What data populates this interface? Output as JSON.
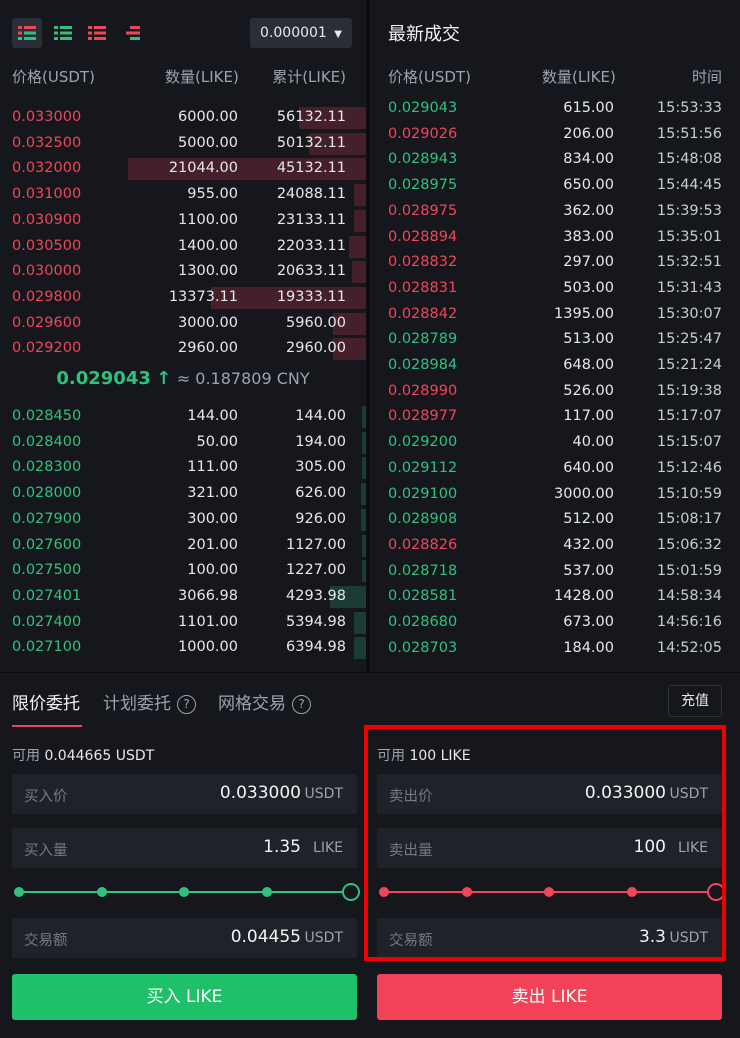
{
  "toolbar": {
    "precision": "0.000001"
  },
  "orderbook": {
    "headers": {
      "price": "价格(USDT)",
      "amount": "数量(LIKE)",
      "total": "累计(LIKE)"
    },
    "asks": [
      {
        "price": "0.033000",
        "amount": "6000.00",
        "total": "56132.11",
        "depth": 0.28
      },
      {
        "price": "0.032500",
        "amount": "5000.00",
        "total": "50132.11",
        "depth": 0.24
      },
      {
        "price": "0.032000",
        "amount": "21044.00",
        "total": "45132.11",
        "depth": 1.0
      },
      {
        "price": "0.031000",
        "amount": "955.00",
        "total": "24088.11",
        "depth": 0.05
      },
      {
        "price": "0.030900",
        "amount": "1100.00",
        "total": "23133.11",
        "depth": 0.05
      },
      {
        "price": "0.030500",
        "amount": "1400.00",
        "total": "22033.11",
        "depth": 0.07
      },
      {
        "price": "0.030000",
        "amount": "1300.00",
        "total": "20633.11",
        "depth": 0.06
      },
      {
        "price": "0.029800",
        "amount": "13373.11",
        "total": "19333.11",
        "depth": 0.65
      },
      {
        "price": "0.029600",
        "amount": "3000.00",
        "total": "5960.00",
        "depth": 0.14
      },
      {
        "price": "0.029200",
        "amount": "2960.00",
        "total": "2960.00",
        "depth": 0.14
      }
    ],
    "mid": {
      "price": "0.029043",
      "arrow": "↑",
      "approx": "≈ 0.187809 CNY"
    },
    "bids": [
      {
        "price": "0.028450",
        "amount": "144.00",
        "total": "144.00",
        "depth": 0.01
      },
      {
        "price": "0.028400",
        "amount": "50.00",
        "total": "194.00",
        "depth": 0.01
      },
      {
        "price": "0.028300",
        "amount": "111.00",
        "total": "305.00",
        "depth": 0.01
      },
      {
        "price": "0.028000",
        "amount": "321.00",
        "total": "626.00",
        "depth": 0.02
      },
      {
        "price": "0.027900",
        "amount": "300.00",
        "total": "926.00",
        "depth": 0.02
      },
      {
        "price": "0.027600",
        "amount": "201.00",
        "total": "1127.00",
        "depth": 0.01
      },
      {
        "price": "0.027500",
        "amount": "100.00",
        "total": "1227.00",
        "depth": 0.01
      },
      {
        "price": "0.027401",
        "amount": "3066.98",
        "total": "4293.98",
        "depth": 0.15
      },
      {
        "price": "0.027400",
        "amount": "1101.00",
        "total": "5394.98",
        "depth": 0.05
      },
      {
        "price": "0.027100",
        "amount": "1000.00",
        "total": "6394.98",
        "depth": 0.05
      }
    ]
  },
  "trades": {
    "title": "最新成交",
    "headers": {
      "price": "价格(USDT)",
      "amount": "数量(LIKE)",
      "time": "时间"
    },
    "rows": [
      {
        "price": "0.029043",
        "amount": "615.00",
        "time": "15:53:33",
        "side": "buy"
      },
      {
        "price": "0.029026",
        "amount": "206.00",
        "time": "15:51:56",
        "side": "sell"
      },
      {
        "price": "0.028943",
        "amount": "834.00",
        "time": "15:48:08",
        "side": "buy"
      },
      {
        "price": "0.028975",
        "amount": "650.00",
        "time": "15:44:45",
        "side": "buy"
      },
      {
        "price": "0.028975",
        "amount": "362.00",
        "time": "15:39:53",
        "side": "sell"
      },
      {
        "price": "0.028894",
        "amount": "383.00",
        "time": "15:35:01",
        "side": "sell"
      },
      {
        "price": "0.028832",
        "amount": "297.00",
        "time": "15:32:51",
        "side": "sell"
      },
      {
        "price": "0.028831",
        "amount": "503.00",
        "time": "15:31:43",
        "side": "sell"
      },
      {
        "price": "0.028842",
        "amount": "1395.00",
        "time": "15:30:07",
        "side": "sell"
      },
      {
        "price": "0.028789",
        "amount": "513.00",
        "time": "15:25:47",
        "side": "buy"
      },
      {
        "price": "0.028984",
        "amount": "648.00",
        "time": "15:21:24",
        "side": "buy"
      },
      {
        "price": "0.028990",
        "amount": "526.00",
        "time": "15:19:38",
        "side": "sell"
      },
      {
        "price": "0.028977",
        "amount": "117.00",
        "time": "15:17:07",
        "side": "sell"
      },
      {
        "price": "0.029200",
        "amount": "40.00",
        "time": "15:15:07",
        "side": "buy"
      },
      {
        "price": "0.029112",
        "amount": "640.00",
        "time": "15:12:46",
        "side": "buy"
      },
      {
        "price": "0.029100",
        "amount": "3000.00",
        "time": "15:10:59",
        "side": "buy"
      },
      {
        "price": "0.028908",
        "amount": "512.00",
        "time": "15:08:17",
        "side": "buy"
      },
      {
        "price": "0.028826",
        "amount": "432.00",
        "time": "15:06:32",
        "side": "sell"
      },
      {
        "price": "0.028718",
        "amount": "537.00",
        "time": "15:01:59",
        "side": "buy"
      },
      {
        "price": "0.028581",
        "amount": "1428.00",
        "time": "14:58:34",
        "side": "buy"
      },
      {
        "price": "0.028680",
        "amount": "673.00",
        "time": "14:56:16",
        "side": "buy"
      },
      {
        "price": "0.028703",
        "amount": "184.00",
        "time": "14:52:05",
        "side": "buy"
      }
    ]
  },
  "order_form": {
    "tabs": [
      "限价委托",
      "计划委托",
      "网格交易"
    ],
    "deposit": "充值",
    "buy": {
      "available_label": "可用",
      "available_value": "0.044665 USDT",
      "price_label": "买入价",
      "price_value": "0.033000",
      "price_unit": "USDT",
      "amount_label": "买入量",
      "amount_value": "1.35",
      "amount_unit": "LIKE",
      "total_label": "交易额",
      "total_value": "0.04455",
      "total_unit": "USDT",
      "slider_percent": 100,
      "button": "买入 LIKE"
    },
    "sell": {
      "available_label": "可用",
      "available_value": "100 LIKE",
      "price_label": "卖出价",
      "price_value": "0.033000",
      "price_unit": "USDT",
      "amount_label": "卖出量",
      "amount_value": "100",
      "amount_unit": "LIKE",
      "total_label": "交易额",
      "total_value": "3.3",
      "total_unit": "USDT",
      "slider_percent": 100,
      "button": "卖出 LIKE"
    }
  },
  "colors": {
    "buy": "#2ec27e",
    "sell": "#f0465a",
    "buy_button": "#1fc06a",
    "sell_button": "#f24257",
    "highlight": "#ee0000"
  }
}
